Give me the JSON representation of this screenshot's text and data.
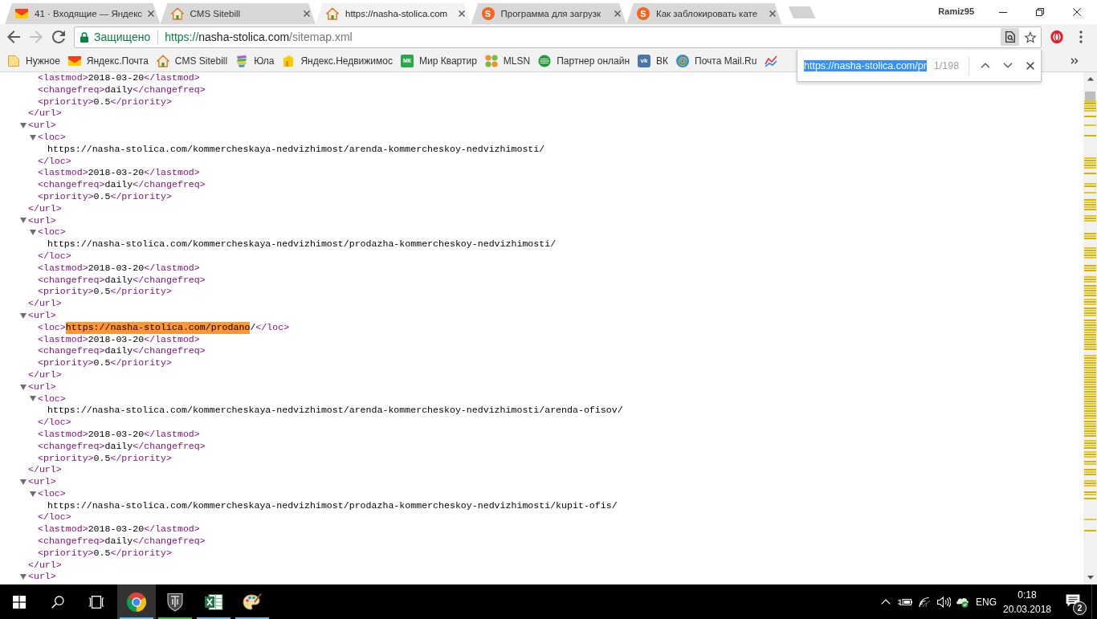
{
  "window": {
    "tabs": [
      {
        "title": "41 · Входящие — Яндекс",
        "selected": false
      },
      {
        "title": "CMS Sitebill",
        "selected": false
      },
      {
        "title": "https://nasha-stolica.com",
        "selected": true
      },
      {
        "title": "Программа для загрузк",
        "selected": false,
        "favicon_text": "S"
      },
      {
        "title": "Как заблокировать кате",
        "selected": false,
        "favicon_text": "S"
      }
    ],
    "profile_name": "Ramiz95"
  },
  "toolbar": {
    "nav_buttons": [
      {
        "kind": "back",
        "disabled": false
      },
      {
        "kind": "forward",
        "disabled": true
      },
      {
        "kind": "reload",
        "disabled": false
      }
    ],
    "security_label": "Защищено",
    "url": {
      "scheme": "https://",
      "host": "nasha-stolica.com",
      "path": "/sitemap.xml"
    },
    "find_in_page_active": true
  },
  "bookmarks": [
    {
      "label": "Нужное"
    },
    {
      "label": "Яндекс.Почта"
    },
    {
      "label": "CMS Sitebill"
    },
    {
      "label": "Юла"
    },
    {
      "label": "Яндекс.Недвижимос"
    },
    {
      "label": "Мир Квартир",
      "icon_text": "МК"
    },
    {
      "label": "MLSN"
    },
    {
      "label": "Партнер онлайн"
    },
    {
      "label": "ВК",
      "icon_text": "vk"
    },
    {
      "label": "Почта Mail.Ru",
      "icon_text": "@"
    }
  ],
  "find_bar": {
    "query": "https://nasha-stolica.com/pr",
    "query_selected": true,
    "count": "1/198"
  },
  "xml": [
    {
      "kind": "element",
      "close_tag": "</url>",
      "children": [
        {
          "kind": "leaf",
          "open_tag": "<lastmod>",
          "value": "2018-03-20",
          "close_tag": "</lastmod>"
        },
        {
          "kind": "leaf",
          "open_tag": "<changefreq>",
          "value": "daily",
          "close_tag": "</changefreq>"
        },
        {
          "kind": "leaf",
          "open_tag": "<priority>",
          "value": "0.5",
          "close_tag": "</priority>"
        }
      ]
    },
    {
      "kind": "element",
      "open_tag": "<url>",
      "expanded": true,
      "close_tag": "</url>",
      "children": [
        {
          "kind": "element",
          "open_tag": "<loc>",
          "expanded": true,
          "close_tag": "</loc>",
          "children": [
            {
              "kind": "text",
              "text": "https://nasha-stolica.com/kommercheskaya-nedvizhimost/arenda-kommercheskoy-nedvizhimosti/"
            }
          ]
        },
        {
          "kind": "leaf",
          "open_tag": "<lastmod>",
          "value": "2018-03-20",
          "close_tag": "</lastmod>"
        },
        {
          "kind": "leaf",
          "open_tag": "<changefreq>",
          "value": "daily",
          "close_tag": "</changefreq>"
        },
        {
          "kind": "leaf",
          "open_tag": "<priority>",
          "value": "0.5",
          "close_tag": "</priority>"
        }
      ]
    },
    {
      "kind": "element",
      "open_tag": "<url>",
      "expanded": true,
      "close_tag": "</url>",
      "children": [
        {
          "kind": "element",
          "open_tag": "<loc>",
          "expanded": true,
          "close_tag": "</loc>",
          "children": [
            {
              "kind": "text",
              "text": "https://nasha-stolica.com/kommercheskaya-nedvizhimost/prodazha-kommercheskoy-nedvizhimosti/"
            }
          ]
        },
        {
          "kind": "leaf",
          "open_tag": "<lastmod>",
          "value": "2018-03-20",
          "close_tag": "</lastmod>"
        },
        {
          "kind": "leaf",
          "open_tag": "<changefreq>",
          "value": "daily",
          "close_tag": "</changefreq>"
        },
        {
          "kind": "leaf",
          "open_tag": "<priority>",
          "value": "0.5",
          "close_tag": "</priority>"
        }
      ]
    },
    {
      "kind": "element",
      "open_tag": "<url>",
      "expanded": true,
      "close_tag": "</url>",
      "children": [
        {
          "kind": "leaf",
          "open_tag": "<loc>",
          "segments": [
            {
              "text": "https://nasha-stolica.com/prodano",
              "highlighted": true
            },
            {
              "text": "/",
              "highlighted": false
            }
          ],
          "close_tag": "</loc>"
        },
        {
          "kind": "leaf",
          "open_tag": "<lastmod>",
          "value": "2018-03-20",
          "close_tag": "</lastmod>"
        },
        {
          "kind": "leaf",
          "open_tag": "<changefreq>",
          "value": "daily",
          "close_tag": "</changefreq>"
        },
        {
          "kind": "leaf",
          "open_tag": "<priority>",
          "value": "0.5",
          "close_tag": "</priority>"
        }
      ]
    },
    {
      "kind": "element",
      "open_tag": "<url>",
      "expanded": true,
      "close_tag": "</url>",
      "children": [
        {
          "kind": "element",
          "open_tag": "<loc>",
          "expanded": true,
          "close_tag": "</loc>",
          "children": [
            {
              "kind": "text",
              "text": "https://nasha-stolica.com/kommercheskaya-nedvizhimost/arenda-kommercheskoy-nedvizhimosti/arenda-ofisov/"
            }
          ]
        },
        {
          "kind": "leaf",
          "open_tag": "<lastmod>",
          "value": "2018-03-20",
          "close_tag": "</lastmod>"
        },
        {
          "kind": "leaf",
          "open_tag": "<changefreq>",
          "value": "daily",
          "close_tag": "</changefreq>"
        },
        {
          "kind": "leaf",
          "open_tag": "<priority>",
          "value": "0.5",
          "close_tag": "</priority>"
        }
      ]
    },
    {
      "kind": "element",
      "open_tag": "<url>",
      "expanded": true,
      "close_tag": "</url>",
      "children": [
        {
          "kind": "element",
          "open_tag": "<loc>",
          "expanded": true,
          "close_tag": "</loc>",
          "children": [
            {
              "kind": "text",
              "text": "https://nasha-stolica.com/kommercheskaya-nedvizhimost/prodazha-kommercheskoy-nedvizhimosti/kupit-ofis/"
            }
          ]
        },
        {
          "kind": "leaf",
          "open_tag": "<lastmod>",
          "value": "2018-03-20",
          "close_tag": "</lastmod>"
        },
        {
          "kind": "leaf",
          "open_tag": "<changefreq>",
          "value": "daily",
          "close_tag": "</changefreq>"
        },
        {
          "kind": "leaf",
          "open_tag": "<priority>",
          "value": "0.5",
          "close_tag": "</priority>"
        }
      ]
    },
    {
      "kind": "element",
      "open_tag": "<url>",
      "expanded": true
    }
  ],
  "taskbar": {
    "apps": [
      {
        "active": true,
        "running": true,
        "color": "#76b9ed"
      },
      {
        "active": false,
        "running": true,
        "color": "#3fbf3f"
      },
      {
        "active": false,
        "running": true,
        "color": "#76b9ed"
      },
      {
        "active": false,
        "running": true,
        "color": "#76b9ed"
      }
    ],
    "language": "ENG",
    "time": "0:18",
    "date": "20.03.2018",
    "notification_count": "2"
  }
}
